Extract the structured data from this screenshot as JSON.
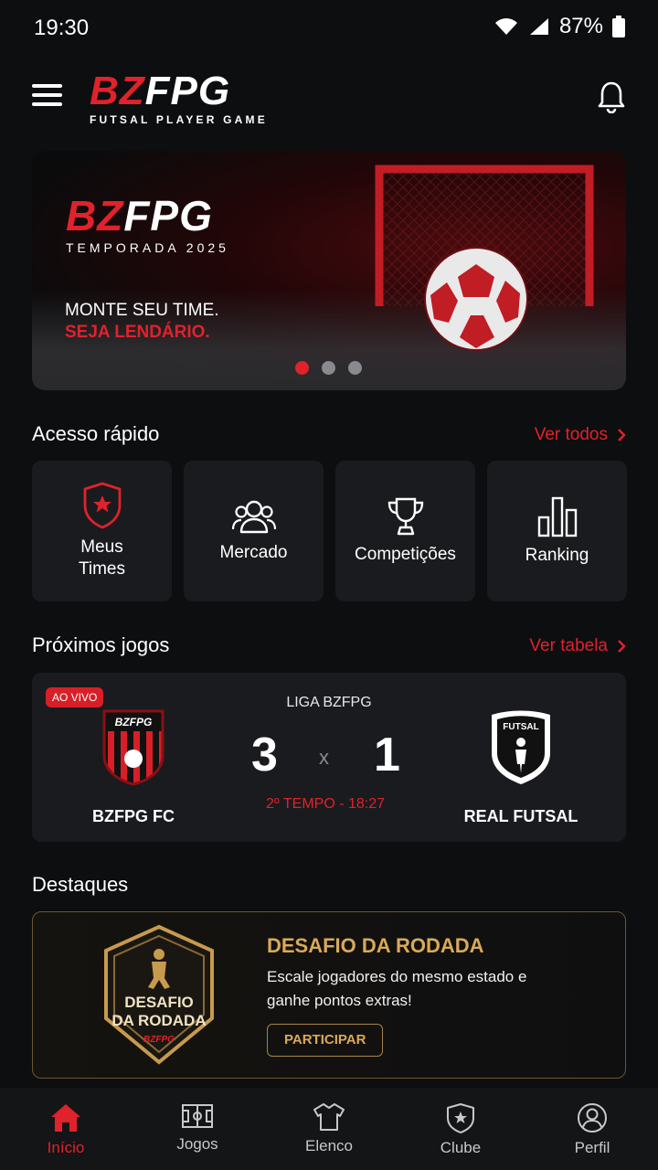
{
  "status_bar": {
    "time": "19:30",
    "battery": "87%"
  },
  "header": {
    "logo_bz": "BZ",
    "logo_fpg": "FPG",
    "logo_sub": "FUTSAL PLAYER GAME"
  },
  "banner": {
    "logo_bz": "BZ",
    "logo_fpg": "FPG",
    "season": "TEMPORADA 2025",
    "line1": "MONTE SEU TIME.",
    "line2": "SEJA LENDÁRIO.",
    "active_slide": 1,
    "slide_count": 3
  },
  "quick_access": {
    "title": "Acesso rápido",
    "link": "Ver todos",
    "items": [
      {
        "label": "Meus\nTimes",
        "icon": "shield-star-icon"
      },
      {
        "label": "Mercado",
        "icon": "users-icon"
      },
      {
        "label": "Competições",
        "icon": "trophy-icon"
      },
      {
        "label": "Ranking",
        "icon": "bar-chart-icon"
      }
    ]
  },
  "next_games": {
    "title": "Próximos jogos",
    "link": "Ver tabela",
    "match": {
      "live_badge": "AO VIVO",
      "league": "LIGA BZFPG",
      "home_team": "BZFPG FC",
      "home_crest_text": "BZFPG",
      "home_score": "3",
      "separator": "x",
      "away_score": "1",
      "away_team": "REAL FUTSAL",
      "away_crest_text": "FUTSAL",
      "period": "2º TEMPO - 18:27"
    }
  },
  "highlights": {
    "title": "Destaques",
    "card": {
      "badge_line1": "DESAFIO",
      "badge_line2": "DA RODADA",
      "badge_logo": "BZFPG",
      "title": "DESAFIO DA RODADA",
      "description": "Escale jogadores do mesmo estado e ganhe pontos extras!",
      "button": "PARTICIPAR"
    }
  },
  "bottom_nav": {
    "items": [
      {
        "label": "Início",
        "icon": "home-icon",
        "active": true
      },
      {
        "label": "Jogos",
        "icon": "pitch-icon",
        "active": false
      },
      {
        "label": "Elenco",
        "icon": "shirt-icon",
        "active": false
      },
      {
        "label": "Clube",
        "icon": "club-shield-icon",
        "active": false
      },
      {
        "label": "Perfil",
        "icon": "profile-icon",
        "active": false
      }
    ]
  },
  "colors": {
    "accent": "#e0222b",
    "gold": "#d9a95a",
    "background": "#0d0e10",
    "card": "#1a1b1e"
  }
}
